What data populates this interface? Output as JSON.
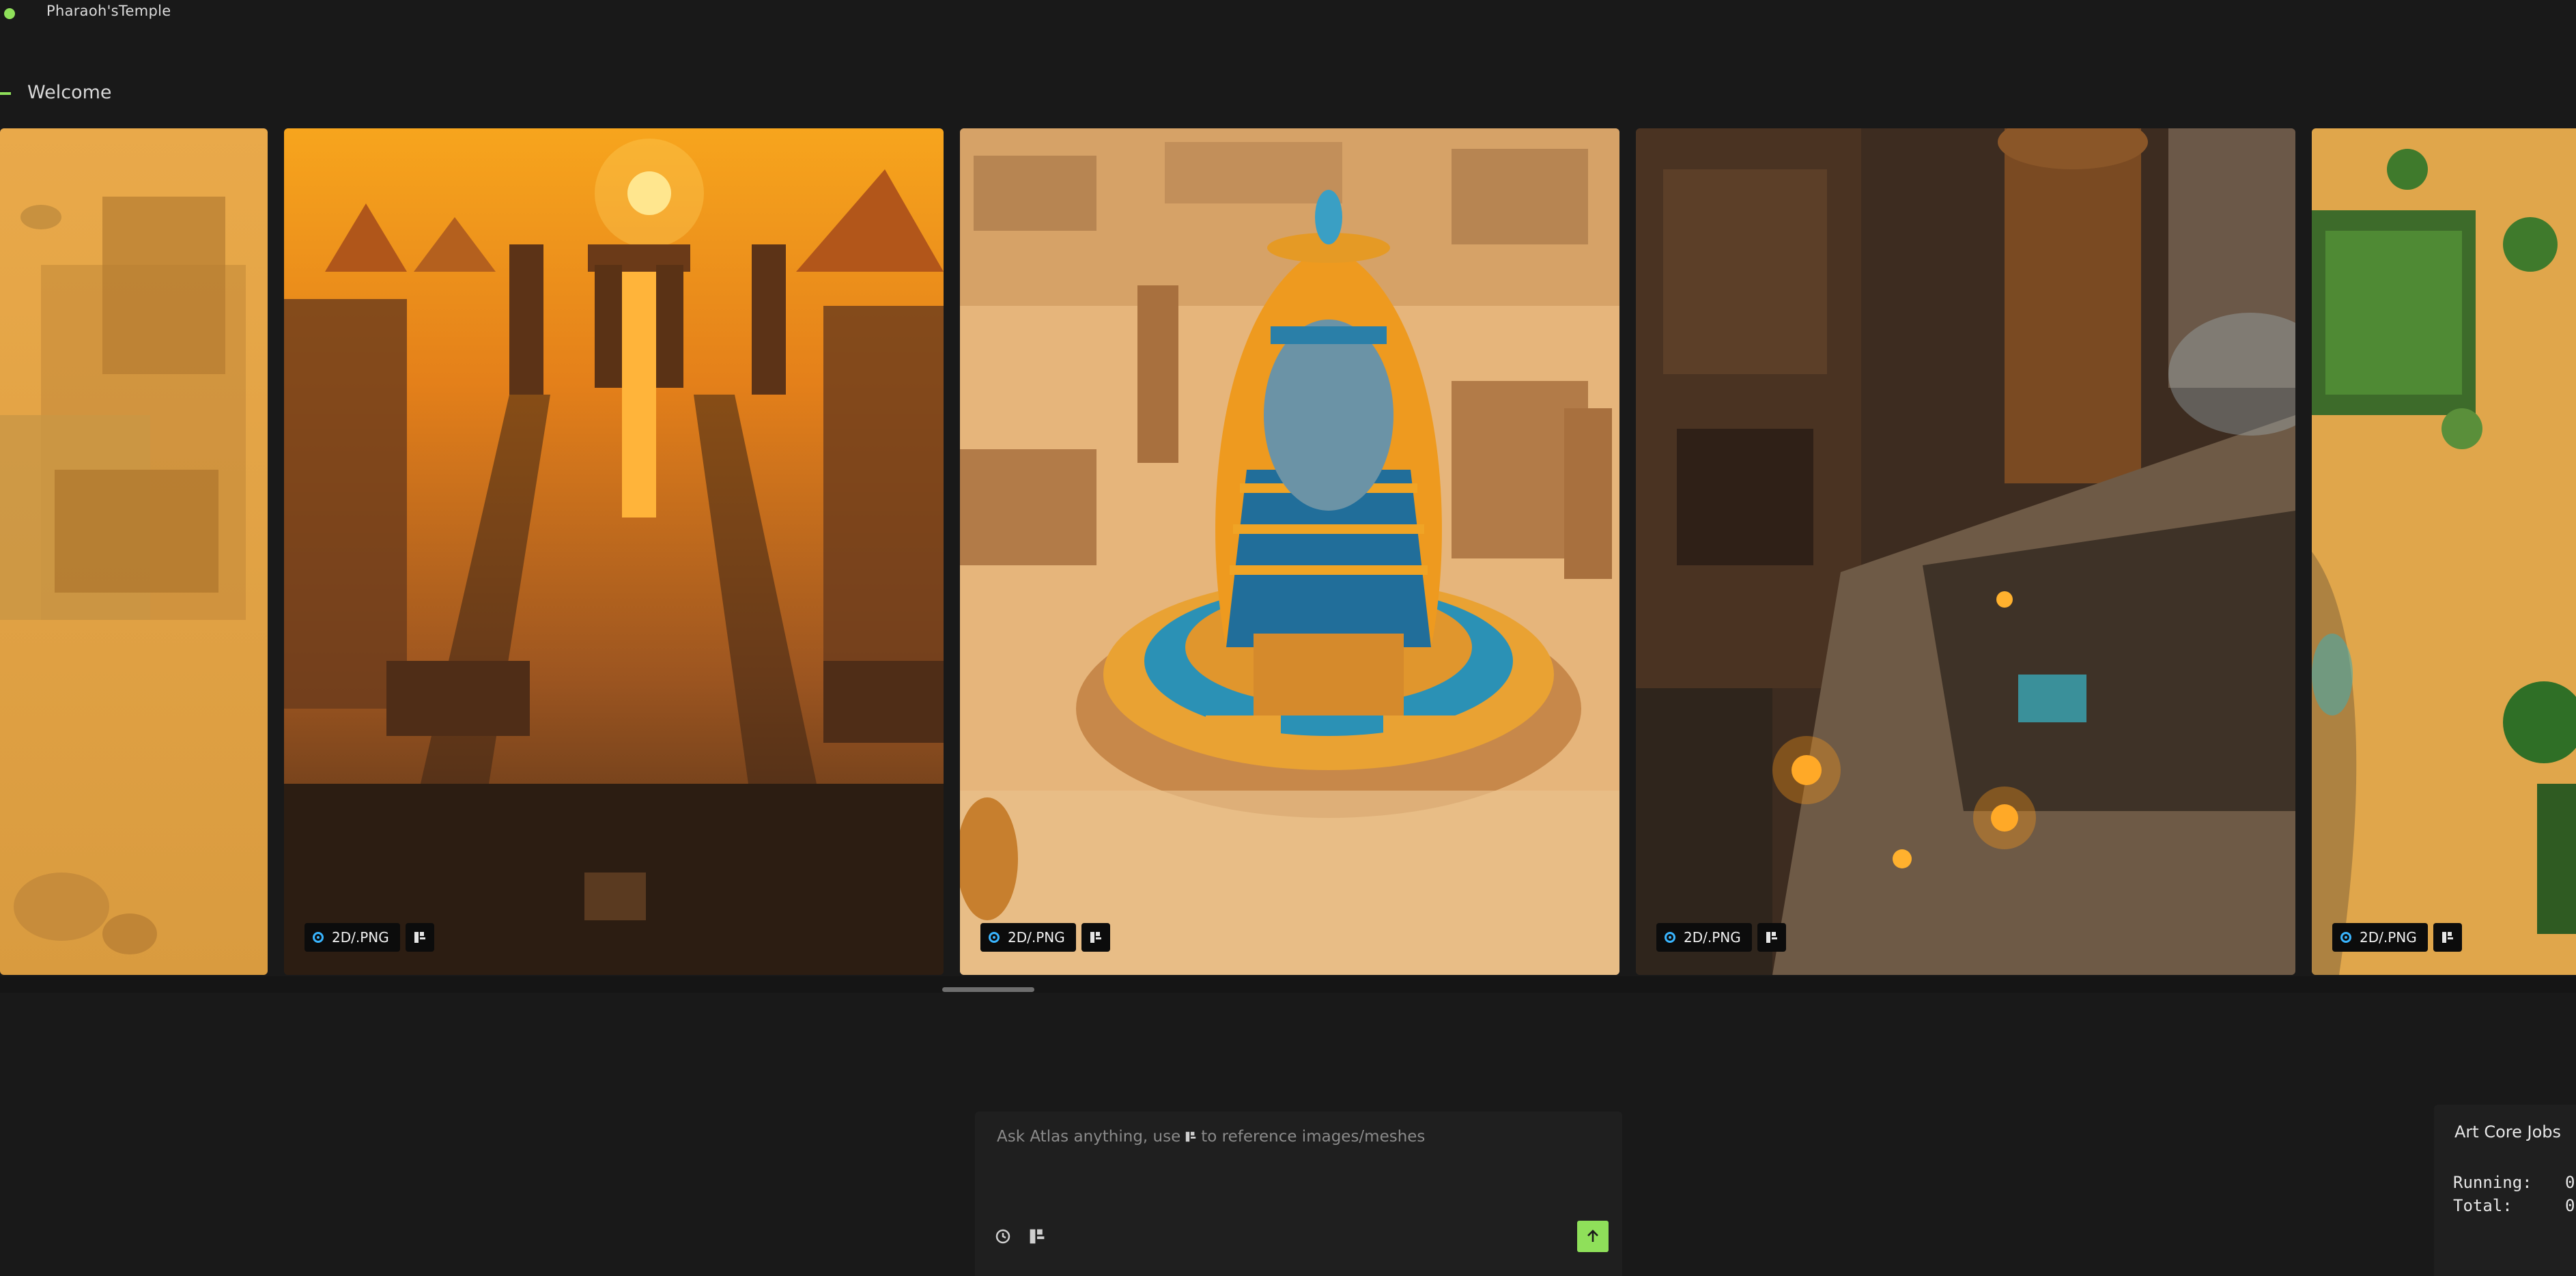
{
  "app": {
    "project_name": "Pharaoh'sTemple"
  },
  "section": {
    "title": "Welcome"
  },
  "gallery": {
    "cards": [
      {
        "scene": "Aerial desert temple complex (partially visible)",
        "badge": null
      },
      {
        "scene": "Sunset temple gate with pyramids",
        "badge": "2D/.PNG"
      },
      {
        "scene": "Giant pharaoh head monument",
        "badge": "2D/.PNG"
      },
      {
        "scene": "Crowded temple plaza with towers and fires",
        "badge": "2D/.PNG"
      },
      {
        "scene": "Oasis with palm trees (partially visible)",
        "badge": "2D/.PNG"
      }
    ]
  },
  "chat": {
    "placeholder_before": "Ask Atlas anything, use",
    "placeholder_after": "to reference images/meshes",
    "send_icon": "arrow-up-icon",
    "accent_color": "#8fe05a"
  },
  "jobs": {
    "title": "Art Core Jobs",
    "running_label": "Running:",
    "running_value": "0",
    "total_label": "Total:",
    "total_value": "0"
  }
}
